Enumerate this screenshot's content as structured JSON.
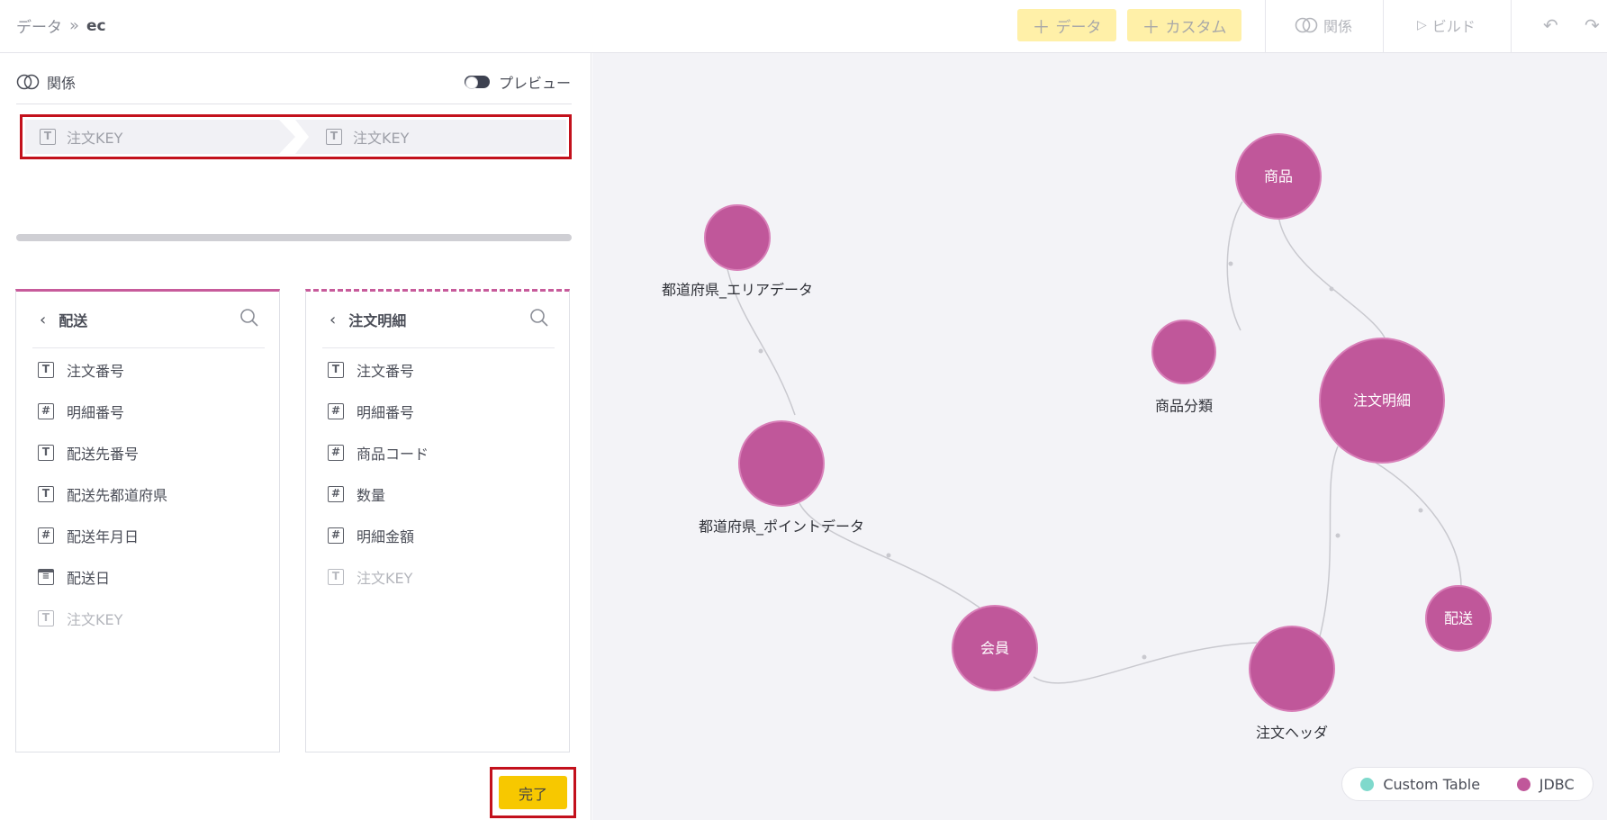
{
  "breadcrumb": {
    "root": "データ",
    "separator": "»",
    "current": "ec"
  },
  "toolbar": {
    "add_data_label": "データ",
    "add_custom_label": "カスタム",
    "relation_label": "関係",
    "build_label": "ビルド"
  },
  "left_panel": {
    "relation_title": "関係",
    "preview_label": "プレビュー",
    "join": {
      "left_field": "注文KEY",
      "right_field": "注文KEY"
    },
    "done_label": "完了"
  },
  "column_panels": [
    {
      "title": "配送",
      "columns": [
        {
          "name": "注文番号",
          "type": "T",
          "dim": false
        },
        {
          "name": "明細番号",
          "type": "#",
          "dim": false
        },
        {
          "name": "配送先番号",
          "type": "T",
          "dim": false
        },
        {
          "name": "配送先都道府県",
          "type": "T",
          "dim": false
        },
        {
          "name": "配送年月日",
          "type": "#",
          "dim": false
        },
        {
          "name": "配送日",
          "type": "cal",
          "dim": false
        },
        {
          "name": "注文KEY",
          "type": "T",
          "dim": true
        }
      ]
    },
    {
      "title": "注文明細",
      "columns": [
        {
          "name": "注文番号",
          "type": "T",
          "dim": false
        },
        {
          "name": "明細番号",
          "type": "#",
          "dim": false
        },
        {
          "name": "商品コード",
          "type": "#",
          "dim": false
        },
        {
          "name": "数量",
          "type": "#",
          "dim": false
        },
        {
          "name": "明細金額",
          "type": "#",
          "dim": false
        },
        {
          "name": "注文KEY",
          "type": "T",
          "dim": true
        }
      ]
    }
  ],
  "graph": {
    "node_color": "#c0579a",
    "nodes": [
      {
        "id": "area",
        "label": "都道府県_エリアデータ",
        "label_inside": false
      },
      {
        "id": "point",
        "label": "都道府県_ポイントデータ",
        "label_inside": false
      },
      {
        "id": "product",
        "label": "商品",
        "label_inside": true
      },
      {
        "id": "category",
        "label": "商品分類",
        "label_inside": false
      },
      {
        "id": "detail",
        "label": "注文明細",
        "label_inside": true
      },
      {
        "id": "member",
        "label": "会員",
        "label_inside": true
      },
      {
        "id": "header",
        "label": "注文ヘッダ",
        "label_inside": false
      },
      {
        "id": "delivery",
        "label": "配送",
        "label_inside": true
      }
    ]
  },
  "legend": [
    {
      "label": "Custom Table",
      "color": "#7fd9cc"
    },
    {
      "label": "JDBC",
      "color": "#c0579a"
    }
  ]
}
